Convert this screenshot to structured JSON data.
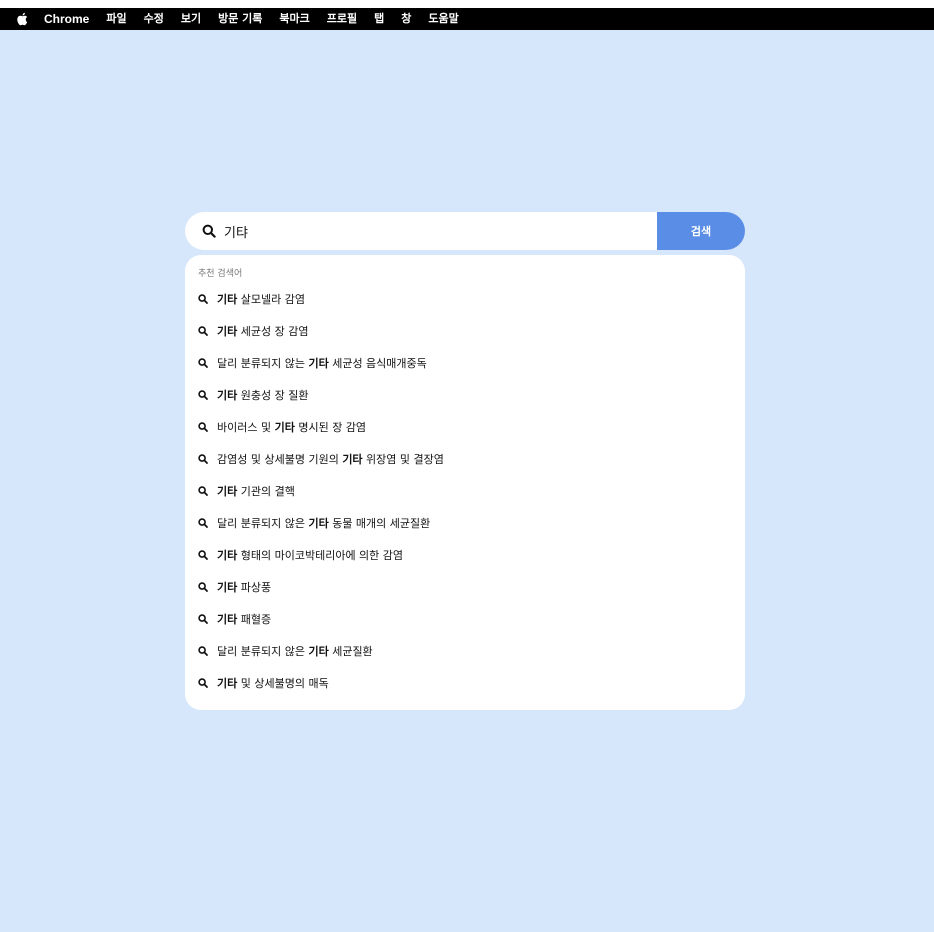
{
  "menubar": {
    "apple_icon": "apple-logo-icon",
    "items": [
      "Chrome",
      "파일",
      "수정",
      "보기",
      "방문 기록",
      "북마크",
      "프로필",
      "탭",
      "창",
      "도움말"
    ]
  },
  "search": {
    "icon": "search-icon",
    "value": "기탸",
    "button_label": "검색"
  },
  "suggestions": {
    "header": "추천 검색어",
    "icon": "search-icon",
    "items": [
      {
        "pre": "",
        "bold": "기타",
        "post": " 살모넬라 감염"
      },
      {
        "pre": "",
        "bold": "기타",
        "post": " 세균성 장 감염"
      },
      {
        "pre": "달리 분류되지 않는 ",
        "bold": "기타",
        "post": " 세균성 음식매개중독"
      },
      {
        "pre": "",
        "bold": "기타",
        "post": " 원충성 장 질환"
      },
      {
        "pre": "바이러스 및 ",
        "bold": "기타",
        "post": " 명시된 장 감염"
      },
      {
        "pre": "감염성 및 상세불명 기원의 ",
        "bold": "기타",
        "post": " 위장염 및 결장염"
      },
      {
        "pre": "",
        "bold": "기타",
        "post": " 기관의 결핵"
      },
      {
        "pre": "달리 분류되지 않은 ",
        "bold": "기타",
        "post": " 동물 매개의 세균질환"
      },
      {
        "pre": "",
        "bold": "기타",
        "post": " 형태의 마이코박테리아에 의한 감염"
      },
      {
        "pre": "",
        "bold": "기타",
        "post": " 파상풍"
      },
      {
        "pre": "",
        "bold": "기타",
        "post": " 패혈증"
      },
      {
        "pre": "달리 분류되지 않은 ",
        "bold": "기타",
        "post": " 세균질환"
      },
      {
        "pre": "",
        "bold": "기타",
        "post": " 및 상세불명의 매독"
      }
    ]
  },
  "colors": {
    "background": "#d6e6fb",
    "accent": "#5a8ee6",
    "menubar": "#000000"
  }
}
